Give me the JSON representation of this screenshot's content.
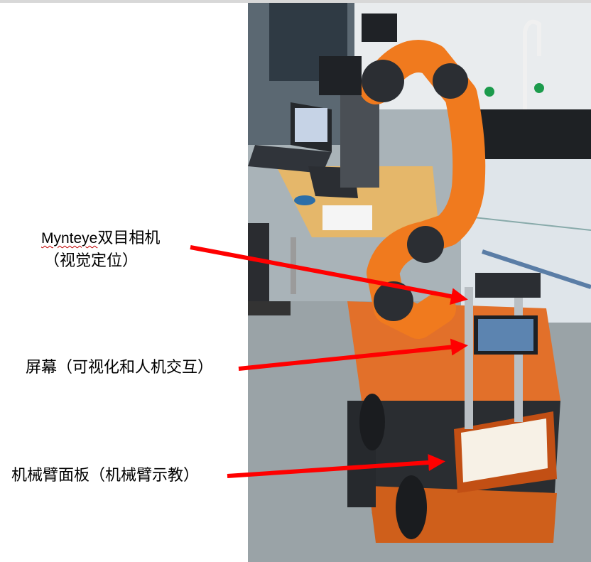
{
  "labels": {
    "mynteye_en": "Mynteye",
    "mynteye_cn": "双目相机",
    "mynteye_sub": "（视觉定位）",
    "screen": "屏幕（可视化和人机交互）",
    "arm_panel": "机械臂面板（机械臂示教）"
  },
  "colors": {
    "arrow": "#ff0000",
    "robot_arm": "#f07a1e",
    "robot_base": "#d9641a",
    "background": "#ffffff"
  },
  "photo": {
    "subject": "orange robotic arm mounted on mobile base in laboratory"
  }
}
